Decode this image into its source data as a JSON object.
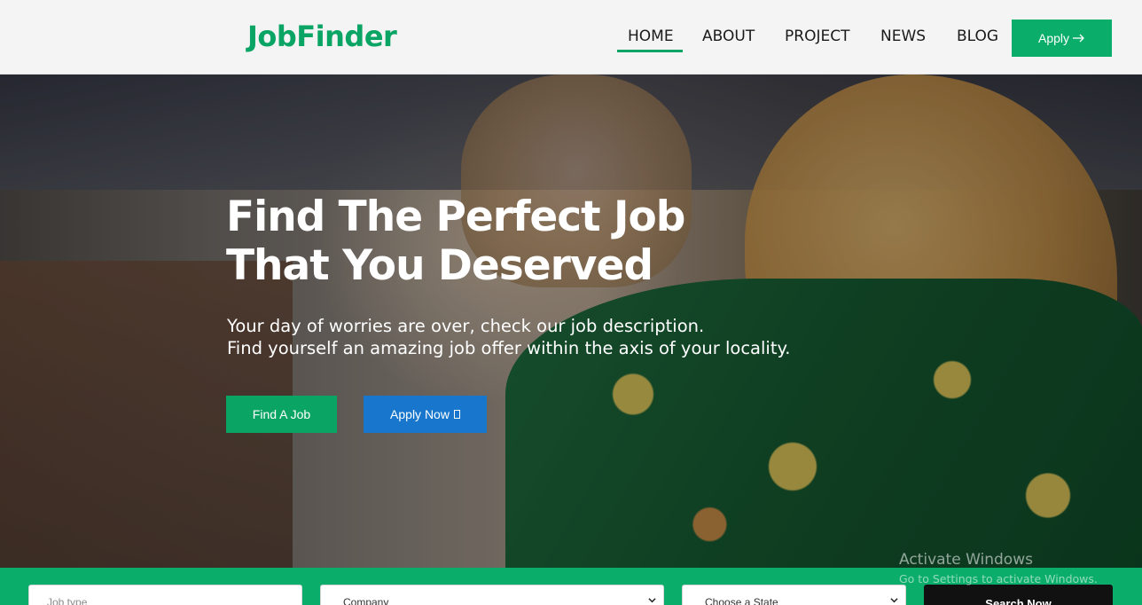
{
  "brand": {
    "name": "JobFinder"
  },
  "nav": {
    "items": [
      {
        "label": "HOME",
        "active": true
      },
      {
        "label": "ABOUT",
        "active": false
      },
      {
        "label": "PROJECT",
        "active": false
      },
      {
        "label": "NEWS",
        "active": false
      },
      {
        "label": "BLOG",
        "active": false
      }
    ],
    "apply_label": "Apply",
    "apply_icon": "arrow-right-icon"
  },
  "hero": {
    "title_line1": "Find The Perfect Job",
    "title_line2": "That You Deserved",
    "subtitle_line1": "Your day of worries are over, check our job description.",
    "subtitle_line2": "Find yourself an amazing job offer within the axis of your locality.",
    "find_button": "Find A Job",
    "apply_button": "Apply Now",
    "apply_button_icon": "box-glyph-icon"
  },
  "search": {
    "job_type_placeholder": "Job type",
    "company_value": "Company",
    "state_value": "Choose a State",
    "button_label": "Search Now"
  },
  "watermark": {
    "title": "Activate Windows",
    "subtitle": "Go to Settings to activate Windows."
  },
  "colors": {
    "brand_green": "#0aa564",
    "apply_blue": "#1877cc",
    "search_bar": "#0aae6a",
    "search_button": "#111111"
  }
}
